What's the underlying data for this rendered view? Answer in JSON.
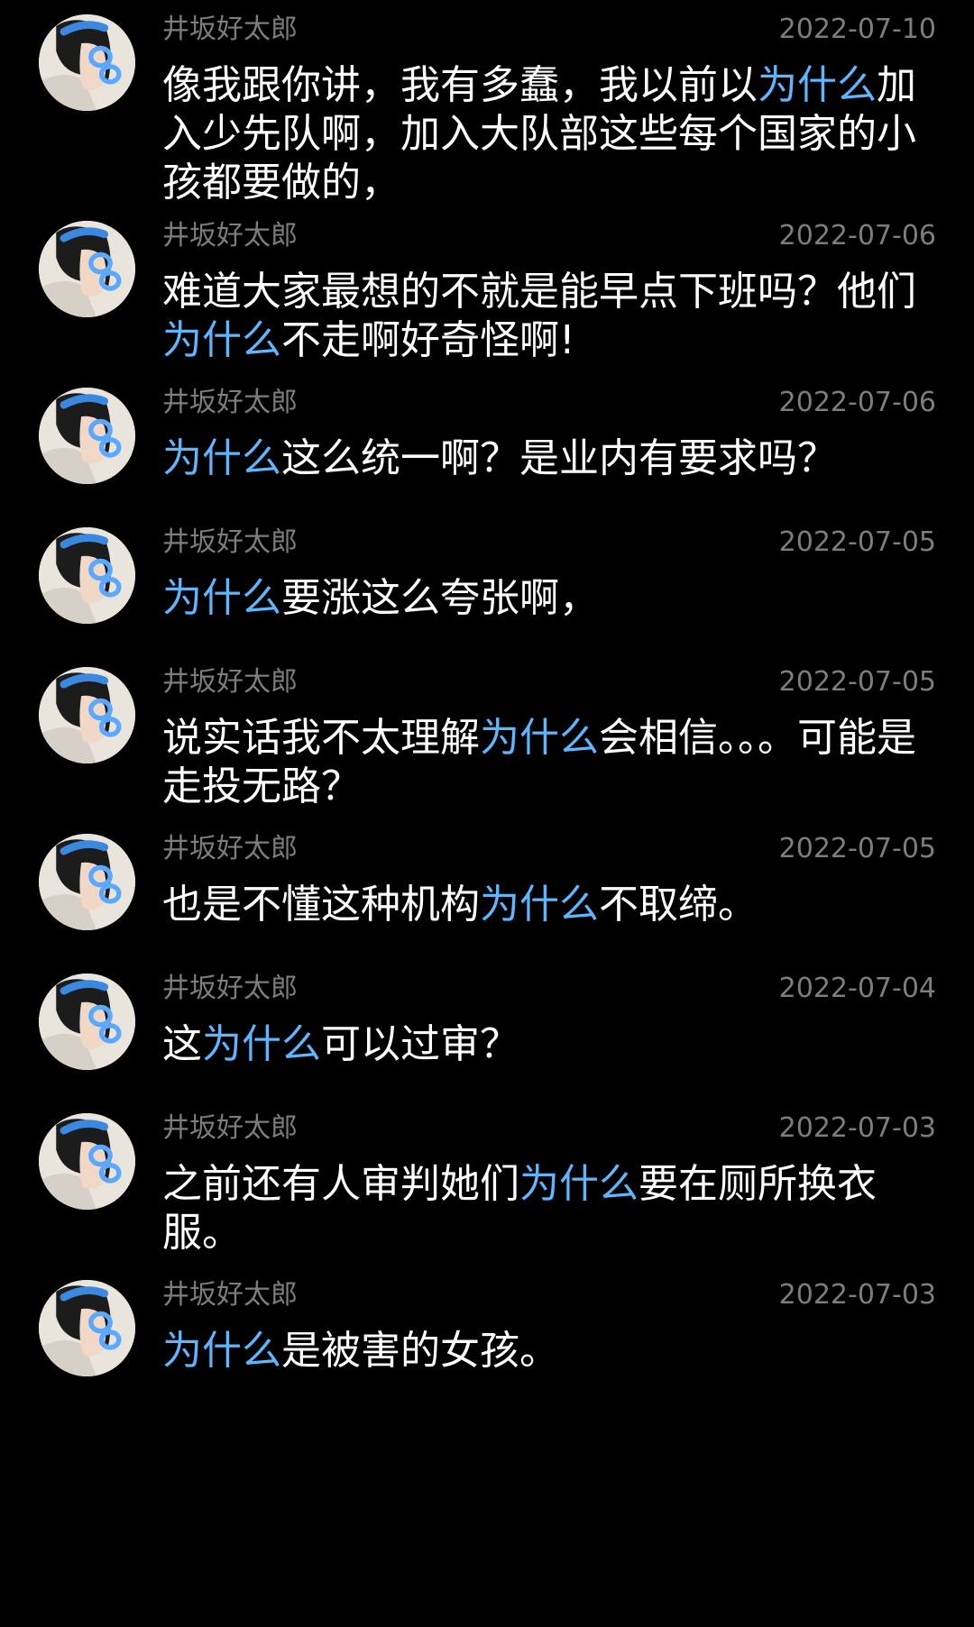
{
  "colors": {
    "background": "#000000",
    "text": "#ffffff",
    "muted": "#7d7d7d",
    "highlight": "#5db6ff"
  },
  "comments": [
    {
      "username": "井坂好太郎",
      "date": "2022-07-10",
      "avatar_icon": "user-avatar-icon",
      "segments": [
        {
          "text": "像我跟你讲，我有多蠢，我以前以",
          "highlight": false
        },
        {
          "text": "为什么",
          "highlight": true
        },
        {
          "text": "加入少先队啊，加入大队部这些每个国家的小孩都要做的，",
          "highlight": false
        }
      ]
    },
    {
      "username": "井坂好太郎",
      "date": "2022-07-06",
      "avatar_icon": "user-avatar-icon",
      "segments": [
        {
          "text": "难道大家最想的不就是能早点下班吗？他们",
          "highlight": false
        },
        {
          "text": "为什么",
          "highlight": true
        },
        {
          "text": "不走啊好奇怪啊!",
          "highlight": false
        }
      ]
    },
    {
      "username": "井坂好太郎",
      "date": "2022-07-06",
      "avatar_icon": "user-avatar-icon",
      "segments": [
        {
          "text": "为什么",
          "highlight": true
        },
        {
          "text": "这么统一啊？是业内有要求吗？",
          "highlight": false
        }
      ]
    },
    {
      "username": "井坂好太郎",
      "date": "2022-07-05",
      "avatar_icon": "user-avatar-icon",
      "segments": [
        {
          "text": "为什么",
          "highlight": true
        },
        {
          "text": "要涨这么夸张啊，",
          "highlight": false
        }
      ]
    },
    {
      "username": "井坂好太郎",
      "date": "2022-07-05",
      "avatar_icon": "user-avatar-icon",
      "segments": [
        {
          "text": "说实话我不太理解",
          "highlight": false
        },
        {
          "text": "为什么",
          "highlight": true
        },
        {
          "text": "会相信。。。可能是走投无路？",
          "highlight": false
        }
      ]
    },
    {
      "username": "井坂好太郎",
      "date": "2022-07-05",
      "avatar_icon": "user-avatar-icon",
      "segments": [
        {
          "text": "也是不懂这种机构",
          "highlight": false
        },
        {
          "text": "为什么",
          "highlight": true
        },
        {
          "text": "不取缔。",
          "highlight": false
        }
      ]
    },
    {
      "username": "井坂好太郎",
      "date": "2022-07-04",
      "avatar_icon": "user-avatar-icon",
      "segments": [
        {
          "text": "这",
          "highlight": false
        },
        {
          "text": "为什么",
          "highlight": true
        },
        {
          "text": "可以过审？",
          "highlight": false
        }
      ]
    },
    {
      "username": "井坂好太郎",
      "date": "2022-07-03",
      "avatar_icon": "user-avatar-icon",
      "segments": [
        {
          "text": "之前还有人审判她们",
          "highlight": false
        },
        {
          "text": "为什么",
          "highlight": true
        },
        {
          "text": "要在厕所换衣服。",
          "highlight": false
        }
      ]
    },
    {
      "username": "井坂好太郎",
      "date": "2022-07-03",
      "avatar_icon": "user-avatar-icon",
      "segments": [
        {
          "text": "为什么",
          "highlight": true
        },
        {
          "text": "是被害的女孩。",
          "highlight": false
        }
      ]
    }
  ]
}
